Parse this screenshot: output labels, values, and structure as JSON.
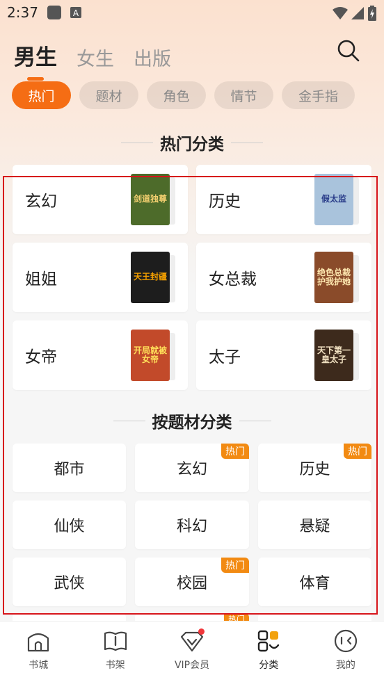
{
  "status_bar": {
    "time": "2:37",
    "a_icon": "A"
  },
  "tabs": [
    {
      "label": "男生",
      "active": true
    },
    {
      "label": "女生",
      "active": false
    },
    {
      "label": "出版",
      "active": false
    }
  ],
  "chips": [
    {
      "label": "热门",
      "active": true
    },
    {
      "label": "题材",
      "active": false
    },
    {
      "label": "角色",
      "active": false
    },
    {
      "label": "情节",
      "active": false
    },
    {
      "label": "金手指",
      "active": false
    }
  ],
  "hot_section": {
    "title": "热门分类",
    "items": [
      {
        "label": "玄幻",
        "cover_text": "剑道独尊",
        "cover_bg": "#4d6b2a",
        "cover_fg": "#f4d070"
      },
      {
        "label": "历史",
        "cover_text": "假太监",
        "cover_bg": "#a9c3dc",
        "cover_fg": "#2b3e8a"
      },
      {
        "label": "姐姐",
        "cover_text": "天王封疆",
        "cover_bg": "#1d1d1d",
        "cover_fg": "#f5a000"
      },
      {
        "label": "女总裁",
        "cover_text": "绝色总裁护我护她",
        "cover_bg": "#8a4b2a",
        "cover_fg": "#ffe8b0"
      },
      {
        "label": "女帝",
        "cover_text": "开局就被女帝",
        "cover_bg": "#c24a2a",
        "cover_fg": "#ffe05a"
      },
      {
        "label": "太子",
        "cover_text": "天下第一皇太子",
        "cover_bg": "#3d2a1c",
        "cover_fg": "#f2e2c2"
      }
    ]
  },
  "topic_section": {
    "title": "按题材分类",
    "items": [
      {
        "label": "都市",
        "badge": ""
      },
      {
        "label": "玄幻",
        "badge": "热门"
      },
      {
        "label": "历史",
        "badge": "热门"
      },
      {
        "label": "仙侠",
        "badge": ""
      },
      {
        "label": "科幻",
        "badge": ""
      },
      {
        "label": "悬疑",
        "badge": ""
      },
      {
        "label": "武侠",
        "badge": ""
      },
      {
        "label": "校园",
        "badge": "热门"
      },
      {
        "label": "体育",
        "badge": ""
      }
    ],
    "peek_badge": "热门"
  },
  "bottom_nav": [
    {
      "label": "书城",
      "icon": "bookstore-icon",
      "active": false
    },
    {
      "label": "书架",
      "icon": "bookshelf-icon",
      "active": false
    },
    {
      "label": "VIP会员",
      "icon": "vip-icon",
      "active": false,
      "dot": true
    },
    {
      "label": "分类",
      "icon": "category-icon",
      "active": true
    },
    {
      "label": "我的",
      "icon": "profile-icon",
      "active": false
    }
  ],
  "colors": {
    "accent": "#f56d14",
    "badge": "#f28a12",
    "highlight": "#d7141a"
  }
}
